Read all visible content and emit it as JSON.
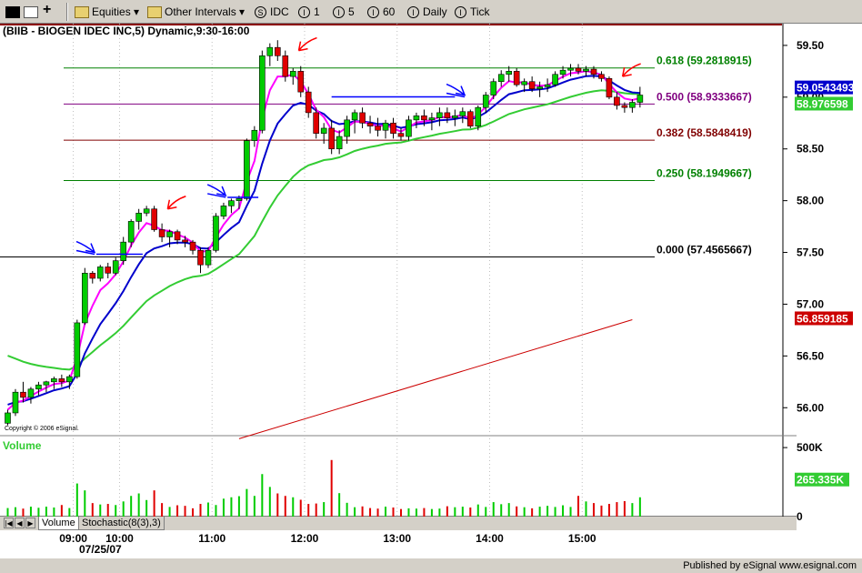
{
  "toolbar": {
    "items": [
      {
        "label": "Equities",
        "icon": "folder-icon"
      },
      {
        "label": "Other Intervals",
        "icon": "folder-icon"
      }
    ],
    "symbol": {
      "glyph": "S",
      "label": "IDC"
    },
    "intervals": [
      {
        "glyph": "I",
        "label": "1"
      },
      {
        "glyph": "I",
        "label": "5"
      },
      {
        "glyph": "I",
        "label": "60"
      },
      {
        "glyph": "I",
        "label": "Daily"
      },
      {
        "glyph": "I",
        "label": "Tick"
      }
    ]
  },
  "chart": {
    "title": "(BIIB - BIOGEN IDEC INC,5) Dynamic,9:30-16:00",
    "copyright": "Copyright © 2006 eSignal.",
    "volume_title": "Volume",
    "date_label": "07/25/07",
    "colors": {
      "up": "#00cc00",
      "down": "#e00000",
      "ma_fast": "#ff00ff",
      "ma_mid": "#0000cc",
      "ma_slow": "#33cc33",
      "trend": "#cc0000",
      "arrow_blue": "#0000ff",
      "arrow_red": "#ff0000"
    }
  },
  "tabs": [
    {
      "label": "Volume"
    },
    {
      "label": "Stochastic(8(3),3)"
    }
  ],
  "status": {
    "text": "Published by eSignal  www.esignal.com"
  },
  "chart_data": {
    "type": "candlestick",
    "title": "(BIIB - BIOGEN IDEC INC,5) Dynamic,9:30-16:00",
    "y_ticks": [
      "59.50",
      "59.00",
      "58.50",
      "58.00",
      "57.50",
      "57.00",
      "56.50",
      "56.00"
    ],
    "ylim": [
      55.73,
      59.71
    ],
    "x_ticks": [
      {
        "label": "09:00",
        "i": 8.5
      },
      {
        "label": "10:00",
        "i": 14.5
      },
      {
        "label": "11:00",
        "i": 26.5
      },
      {
        "label": "12:00",
        "i": 38.5
      },
      {
        "label": "13:00",
        "i": 50.5
      },
      {
        "label": "14:00",
        "i": 62.5
      },
      {
        "label": "15:00",
        "i": 74.5
      }
    ],
    "fib_levels": [
      {
        "label": "0.618 (59.2818915)",
        "value": 59.2818915,
        "color": "#008000"
      },
      {
        "label": "0.500 (58.9333667)",
        "value": 58.9333667,
        "color": "#800080"
      },
      {
        "label": "0.382 (58.5848419)",
        "value": 58.5848419,
        "color": "#800000"
      },
      {
        "label": "0.250 (58.1949667)",
        "value": 58.1949667,
        "color": "#008000"
      },
      {
        "label": "0.000 (57.4565667)",
        "value": 57.4565667,
        "color": "#000000"
      }
    ],
    "price_tags": [
      {
        "label": "59.0543493",
        "value": 59.0543493,
        "bg": "#0000cc",
        "fg": "#ffffff"
      },
      {
        "label": "58.976598",
        "value": 58.976598,
        "bg": "#33cc33",
        "fg": "#ffffff"
      },
      {
        "label": "56.859185",
        "value": 56.859185,
        "bg": "#cc0000",
        "fg": "#ffffff"
      }
    ],
    "ohlc": [
      [
        55.85,
        55.98,
        55.83,
        55.95
      ],
      [
        55.95,
        56.18,
        55.92,
        56.15
      ],
      [
        56.15,
        56.25,
        56.05,
        56.1
      ],
      [
        56.1,
        56.2,
        56.04,
        56.18
      ],
      [
        56.18,
        56.25,
        56.12,
        56.22
      ],
      [
        56.22,
        56.26,
        56.15,
        56.25
      ],
      [
        56.25,
        56.3,
        56.18,
        56.28
      ],
      [
        56.28,
        56.32,
        56.2,
        56.25
      ],
      [
        56.25,
        56.32,
        56.18,
        56.3
      ],
      [
        56.3,
        56.85,
        56.28,
        56.82
      ],
      [
        56.82,
        57.35,
        56.8,
        57.3
      ],
      [
        57.3,
        57.32,
        57.2,
        57.25
      ],
      [
        57.25,
        57.38,
        57.22,
        57.36
      ],
      [
        57.36,
        57.4,
        57.25,
        57.3
      ],
      [
        57.3,
        57.45,
        57.28,
        57.42
      ],
      [
        57.42,
        57.65,
        57.38,
        57.6
      ],
      [
        57.6,
        57.82,
        57.55,
        57.8
      ],
      [
        57.8,
        57.92,
        57.72,
        57.88
      ],
      [
        57.88,
        57.95,
        57.85,
        57.92
      ],
      [
        57.92,
        57.95,
        57.7,
        57.72
      ],
      [
        57.72,
        57.78,
        57.6,
        57.65
      ],
      [
        57.65,
        57.72,
        57.55,
        57.7
      ],
      [
        57.7,
        57.72,
        57.58,
        57.62
      ],
      [
        57.62,
        57.66,
        57.55,
        57.6
      ],
      [
        57.6,
        57.62,
        57.48,
        57.52
      ],
      [
        57.52,
        57.55,
        57.3,
        57.38
      ],
      [
        57.38,
        57.55,
        57.35,
        57.52
      ],
      [
        57.52,
        57.88,
        57.5,
        57.85
      ],
      [
        57.85,
        57.98,
        57.82,
        57.95
      ],
      [
        57.95,
        58.02,
        57.88,
        58.0
      ],
      [
        58.0,
        58.05,
        57.92,
        58.02
      ],
      [
        58.02,
        58.6,
        58.0,
        58.58
      ],
      [
        58.58,
        58.72,
        58.52,
        58.68
      ],
      [
        58.68,
        59.45,
        58.65,
        59.4
      ],
      [
        59.4,
        59.52,
        59.3,
        59.48
      ],
      [
        59.48,
        59.55,
        59.35,
        59.4
      ],
      [
        59.4,
        59.45,
        59.15,
        59.2
      ],
      [
        59.2,
        59.28,
        59.12,
        59.25
      ],
      [
        59.25,
        59.3,
        59.0,
        59.05
      ],
      [
        59.05,
        59.1,
        58.8,
        58.85
      ],
      [
        58.85,
        58.9,
        58.6,
        58.65
      ],
      [
        58.65,
        58.75,
        58.55,
        58.7
      ],
      [
        58.7,
        58.78,
        58.45,
        58.5
      ],
      [
        58.5,
        58.68,
        58.45,
        58.62
      ],
      [
        58.62,
        58.82,
        58.55,
        58.78
      ],
      [
        58.78,
        58.88,
        58.65,
        58.85
      ],
      [
        58.85,
        58.9,
        58.7,
        58.75
      ],
      [
        58.75,
        58.82,
        58.65,
        58.72
      ],
      [
        58.72,
        58.8,
        58.62,
        58.68
      ],
      [
        58.68,
        58.78,
        58.6,
        58.75
      ],
      [
        58.75,
        58.8,
        58.6,
        58.65
      ],
      [
        58.65,
        58.7,
        58.58,
        58.62
      ],
      [
        58.62,
        58.82,
        58.58,
        58.78
      ],
      [
        58.78,
        58.85,
        58.7,
        58.82
      ],
      [
        58.82,
        58.88,
        58.72,
        58.78
      ],
      [
        58.78,
        58.85,
        58.68,
        58.8
      ],
      [
        58.8,
        58.9,
        58.72,
        58.85
      ],
      [
        58.85,
        58.9,
        58.75,
        58.8
      ],
      [
        58.8,
        58.88,
        58.72,
        58.82
      ],
      [
        58.82,
        58.9,
        58.75,
        58.86
      ],
      [
        58.86,
        58.88,
        58.7,
        58.72
      ],
      [
        58.72,
        58.92,
        58.68,
        58.9
      ],
      [
        58.9,
        59.05,
        58.85,
        59.02
      ],
      [
        59.02,
        59.18,
        58.98,
        59.15
      ],
      [
        59.15,
        59.26,
        59.1,
        59.22
      ],
      [
        59.22,
        59.3,
        59.15,
        59.25
      ],
      [
        59.25,
        59.28,
        59.1,
        59.12
      ],
      [
        59.12,
        59.18,
        59.05,
        59.15
      ],
      [
        59.15,
        59.2,
        59.05,
        59.08
      ],
      [
        59.08,
        59.15,
        59.0,
        59.1
      ],
      [
        59.1,
        59.18,
        59.05,
        59.12
      ],
      [
        59.12,
        59.25,
        59.1,
        59.22
      ],
      [
        59.22,
        59.3,
        59.18,
        59.26
      ],
      [
        59.26,
        59.32,
        59.2,
        59.28
      ],
      [
        59.28,
        59.32,
        59.22,
        59.25
      ],
      [
        59.25,
        59.3,
        59.2,
        59.27
      ],
      [
        59.27,
        59.3,
        59.18,
        59.22
      ],
      [
        59.22,
        59.25,
        59.15,
        59.18
      ],
      [
        59.18,
        59.2,
        58.98,
        59.0
      ],
      [
        59.0,
        59.05,
        58.88,
        58.92
      ],
      [
        58.92,
        58.95,
        58.85,
        58.9
      ],
      [
        58.9,
        58.98,
        58.85,
        58.95
      ],
      [
        58.95,
        59.1,
        58.9,
        59.02
      ]
    ],
    "volume": [
      62,
      68,
      58,
      72,
      64,
      72,
      66,
      84,
      62,
      240,
      190,
      98,
      88,
      92,
      84,
      110,
      150,
      168,
      120,
      190,
      98,
      70,
      82,
      78,
      60,
      92,
      102,
      84,
      130,
      140,
      148,
      200,
      150,
      308,
      215,
      168,
      150,
      140,
      122,
      92,
      95,
      105,
      410,
      170,
      100,
      68,
      74,
      62,
      58,
      72,
      66,
      55,
      60,
      58,
      62,
      55,
      58,
      75,
      68,
      72,
      66,
      88,
      70,
      105,
      90,
      98,
      74,
      68,
      60,
      72,
      78,
      70,
      82,
      70,
      150,
      110,
      98,
      80,
      92,
      105,
      112,
      98,
      140
    ],
    "volume_ticks": [
      {
        "label": "500K",
        "value": 500
      },
      {
        "label": "0",
        "value": 0
      }
    ],
    "volume_tag": {
      "label": "265.335K",
      "value": 265.335
    },
    "volume_max": 560,
    "trend_line": {
      "from": [
        {
          "i": 30
        },
        {
          "price": 55.7
        }
      ],
      "to": [
        {
          "i": 81
        },
        {
          "price": 56.85
        }
      ]
    },
    "arrows": [
      {
        "color": "blue",
        "i": 11.5,
        "price": 57.5,
        "hline_to": 17.5
      },
      {
        "color": "red",
        "i": 20.5,
        "price": 57.92
      },
      {
        "color": "blue",
        "i": 28.5,
        "price": 58.05,
        "hline_to": 32.5
      },
      {
        "color": "red",
        "i": 37.5,
        "price": 59.45
      },
      {
        "color": "blue",
        "i": 59.5,
        "price": 59.02,
        "hline_from": 42,
        "hline_to": 58
      },
      {
        "color": "red",
        "i": 79.5,
        "price": 59.2
      }
    ]
  }
}
